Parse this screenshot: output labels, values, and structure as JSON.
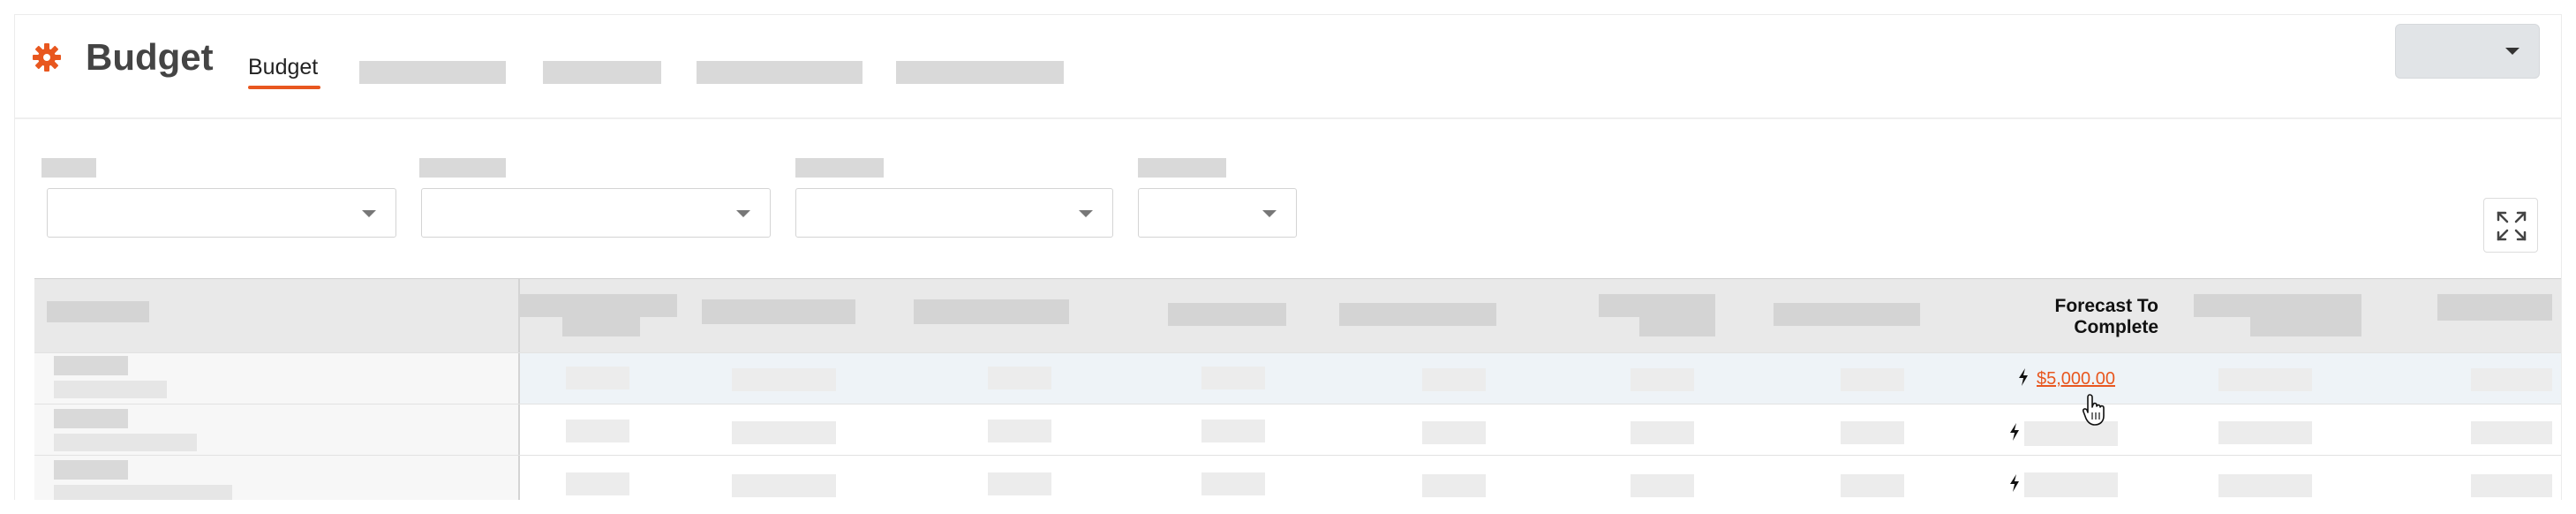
{
  "header": {
    "title": "Budget",
    "active_tab": "Budget",
    "accent_color": "#e8571f",
    "logo_icon": "gear-icon"
  },
  "table": {
    "forecast_column": {
      "header": "Forecast To Complete",
      "first_row_value": "$5,000.00",
      "row_icon": "lightning-bolt-icon"
    }
  }
}
